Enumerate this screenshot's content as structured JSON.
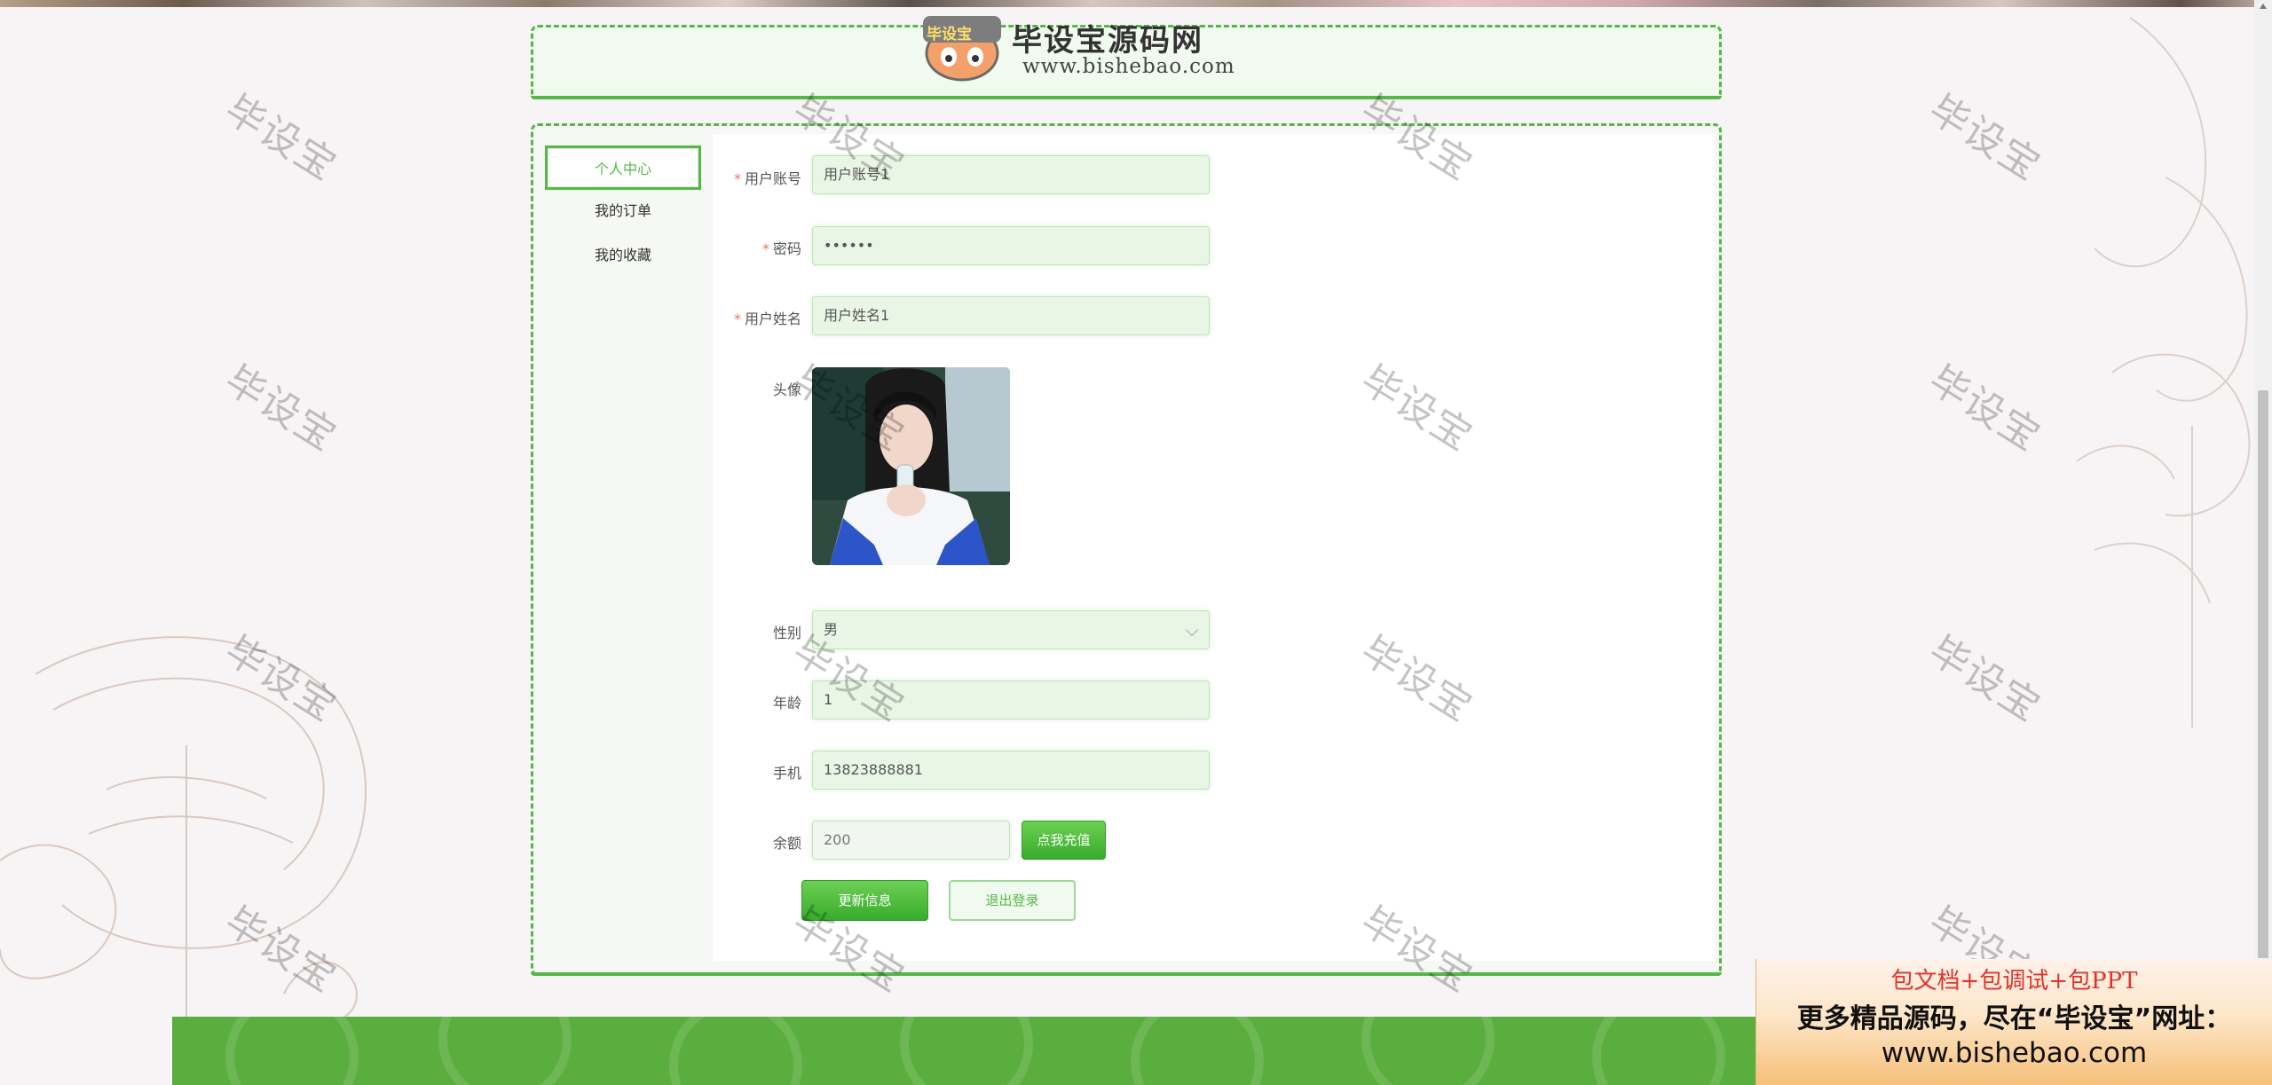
{
  "header": {
    "logo_badge_text": "毕设宝",
    "logo_title": "毕设宝源码网",
    "logo_url": "www.bishebao.com"
  },
  "watermark_text": "毕设宝",
  "sidebar": {
    "items": [
      {
        "label": "个人中心",
        "active": true
      },
      {
        "label": "我的订单",
        "active": false
      },
      {
        "label": "我的收藏",
        "active": false
      }
    ]
  },
  "form": {
    "account": {
      "label": "用户账号",
      "required": true,
      "value": "用户账号1"
    },
    "password": {
      "label": "密码",
      "required": true,
      "value": "••••••"
    },
    "name": {
      "label": "用户姓名",
      "required": true,
      "value": "用户姓名1"
    },
    "avatar": {
      "label": "头像"
    },
    "gender": {
      "label": "性别",
      "value": "男"
    },
    "age": {
      "label": "年龄",
      "value": "1"
    },
    "phone": {
      "label": "手机",
      "value": "13823888881"
    },
    "balance": {
      "label": "余额",
      "value": "200",
      "recharge_label": "点我充值"
    },
    "update_label": "更新信息",
    "logout_label": "退出登录"
  },
  "ad": {
    "top": "包文档+包调试+包PPT",
    "middle": "更多精品源码，尽在“毕设宝”网址：",
    "url": "www.bishebao.com"
  },
  "colors": {
    "accent": "#55b748",
    "required": "#f56c6c",
    "footer": "#5aae3d"
  }
}
